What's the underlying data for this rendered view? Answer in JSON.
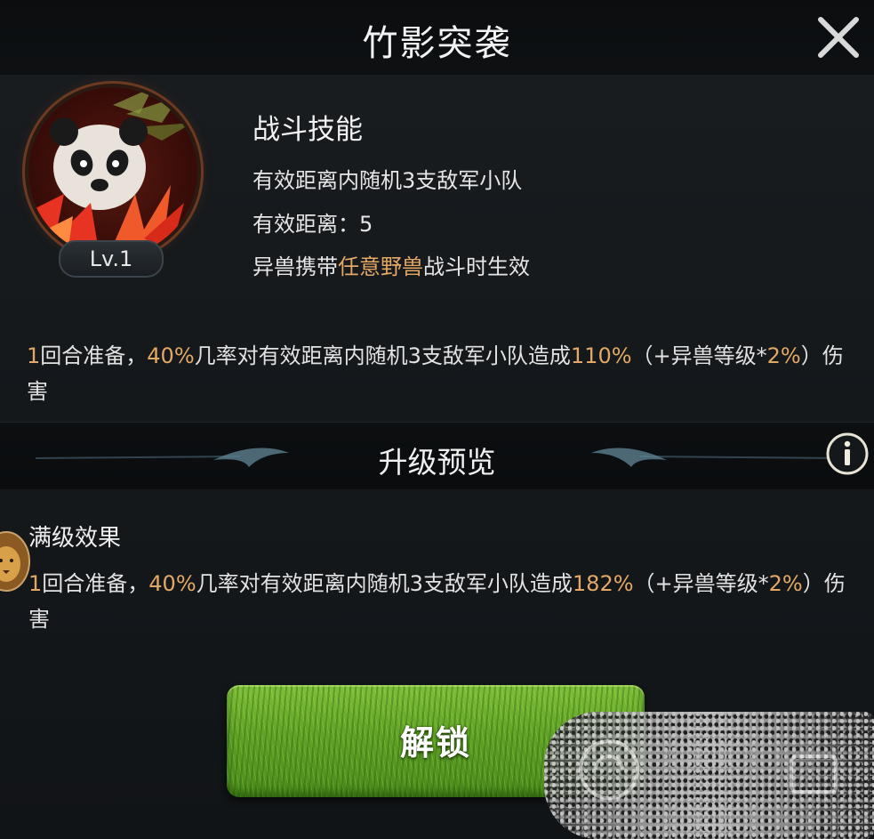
{
  "header": {
    "title": "竹影突袭",
    "close_icon": "close-icon"
  },
  "skill": {
    "level_badge": "Lv.1",
    "type_label": "战斗技能",
    "line1": "有效距离内随机3支敌军小队",
    "line2": "有效距离：5",
    "line3_prefix": "异兽携带",
    "line3_highlight": "任意野兽",
    "line3_suffix": "战斗时生效",
    "desc": {
      "p1": "1",
      "p2": "回合准备，",
      "p3": "40%",
      "p4": "几率对有效距离内随机3支敌军小队造成",
      "p5": "110%",
      "p6": "（+异兽等级",
      "p7": "*",
      "p8": "2%",
      "p9": "）伤害"
    }
  },
  "preview": {
    "title": "升级预览",
    "info_icon": "info-icon"
  },
  "max_level": {
    "title": "满级效果",
    "desc": {
      "p1": "1",
      "p2": "回合准备，",
      "p3": "40%",
      "p4": "几率对有效距离内随机3支敌军小队造成",
      "p5": "182%",
      "p6": "（+异兽等级",
      "p7": "*",
      "p8": "2%",
      "p9": "）伤害"
    }
  },
  "unlock_button": {
    "label": "解锁"
  },
  "colors": {
    "highlight": "#e3a865",
    "text": "#e6e6e6",
    "button_green": "#5fa326",
    "background": "#14181b"
  }
}
